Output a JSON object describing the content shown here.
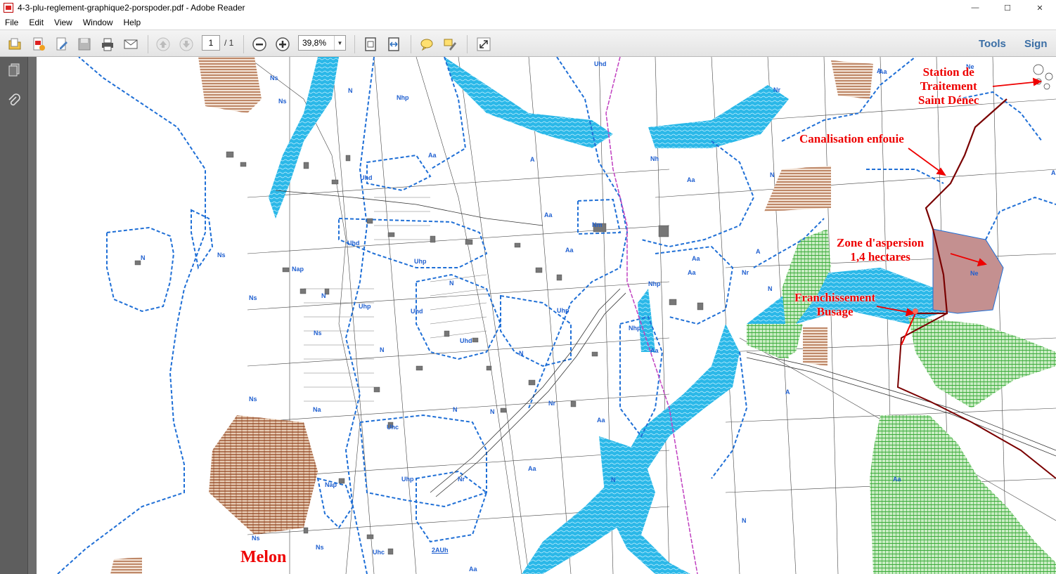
{
  "window": {
    "title": "4-3-plu-reglement-graphique2-porspoder.pdf - Adobe Reader",
    "controls": [
      "—",
      "☐",
      "✕"
    ]
  },
  "menu": {
    "items": [
      "File",
      "Edit",
      "View",
      "Window",
      "Help"
    ]
  },
  "toolbar": {
    "page_current": "1",
    "page_total": "/ 1",
    "zoom": "39,8%",
    "tools_label": "Tools",
    "sign_label": "Sign"
  },
  "map": {
    "annotations": {
      "station": "Station de\nTraitement\nSaint Dénec",
      "canalisation": "Canalisation enfouie",
      "zone": "Zone d'aspersion\n1,4 hectares",
      "franchissement": "Franchissement\nBusage",
      "melon": "Melon"
    },
    "zone_labels": [
      "Uhd",
      "N",
      "Nhp",
      "Ns",
      "Aa",
      "A",
      "Nh",
      "Nr",
      "Aa",
      "Uhd",
      "Aa",
      "Nm",
      "Ns",
      "N",
      "Uhd",
      "Aa",
      "Aa",
      "Nap",
      "Uhp",
      "N",
      "Aa",
      "Nr",
      "Nhp",
      "Ns",
      "N",
      "Uhp",
      "Uhd",
      "Uhp",
      "Ns",
      "Uhd",
      "N",
      "Ne",
      "N",
      "A",
      "Ns",
      "Na",
      "Uhc",
      "N",
      "Nr",
      "Aa",
      "N",
      "Nap",
      "Uhp",
      "Nr",
      "Aa",
      "N",
      "Ns",
      "Uhc",
      "2AUh",
      "Aa",
      "N",
      "Aa",
      "Nhp",
      "Aa",
      "A",
      "N",
      "N",
      "Ns",
      "A",
      "Ne",
      "Aa",
      "N",
      "A",
      "Ns"
    ]
  },
  "colors": {
    "water": "#2bb8e8",
    "zone_border": "#1f6fd6",
    "hatch_brown": "#9a4a1e",
    "hatch_green": "#3aaa3a",
    "aspersion_fill": "#c49090",
    "annotation": "#e00000"
  }
}
